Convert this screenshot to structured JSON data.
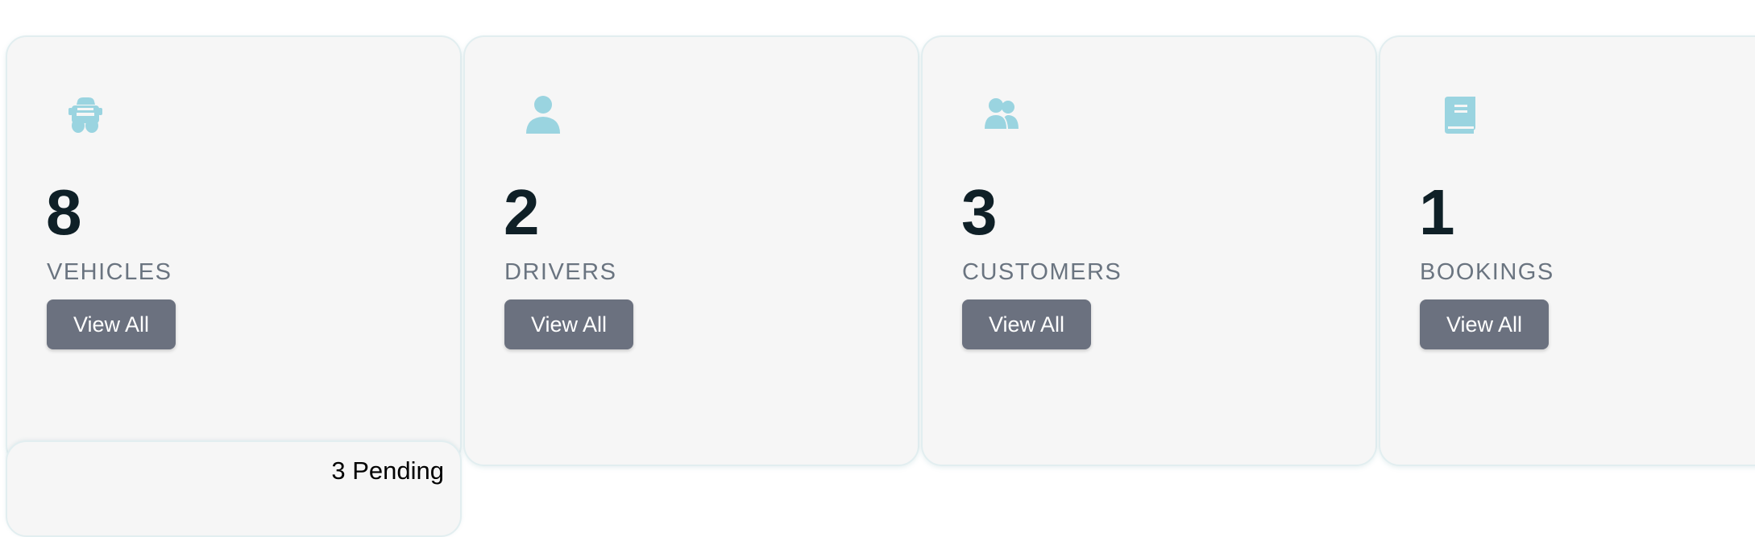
{
  "accent_color": "#9ad4e0",
  "cards": [
    {
      "icon": "car-icon",
      "count": "8",
      "label": "VEHICLES",
      "button": "View All"
    },
    {
      "icon": "user-icon",
      "count": "2",
      "label": "DRIVERS",
      "button": "View All"
    },
    {
      "icon": "users-icon",
      "count": "3",
      "label": "CUSTOMERS",
      "button": "View All"
    },
    {
      "icon": "book-icon",
      "count": "1",
      "label": "BOOKINGS",
      "button": "View All"
    }
  ],
  "pending": {
    "text": "3 Pending"
  }
}
